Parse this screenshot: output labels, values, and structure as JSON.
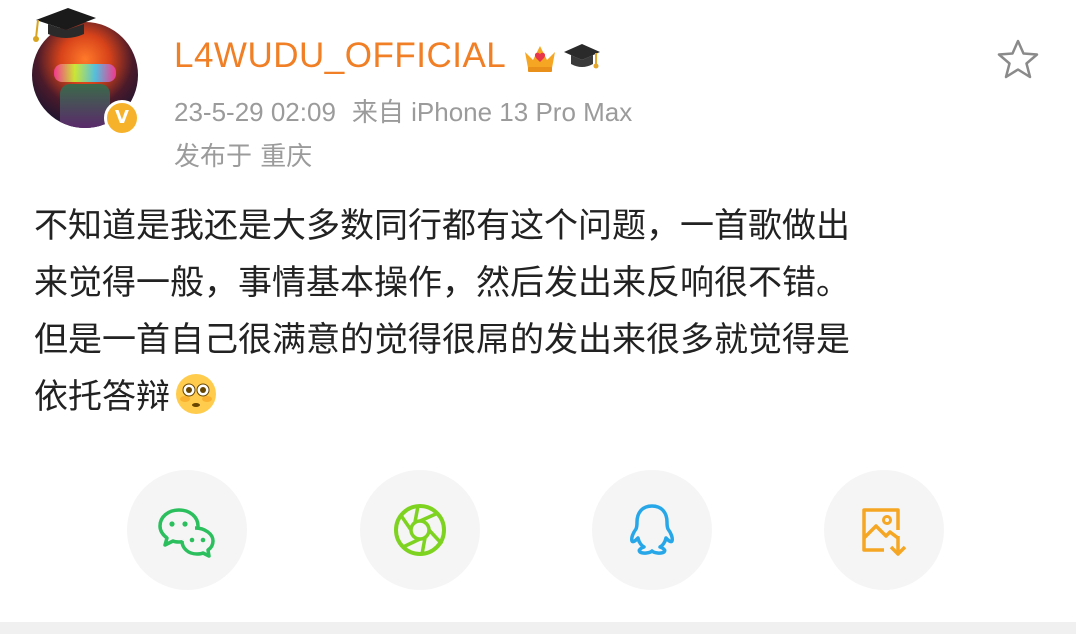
{
  "post": {
    "username": "L4WUDU_OFFICIAL",
    "timestamp": "23-5-29 02:09",
    "source": "来自 iPhone 13 Pro Max",
    "location": "发布于 重庆",
    "text_line1": "不知道是我还是大多数同行都有这个问题，一首歌做出",
    "text_line2": "来觉得一般，事情基本操作，然后发出来反响很不错。",
    "text_line3": "但是一首自己很满意的觉得很屌的发出来很多就觉得是",
    "text_line4": "依托答辩",
    "verified_mark": "V",
    "emoji": "flushed-face"
  },
  "colors": {
    "username": "#f07f25",
    "meta": "#9b9b9b",
    "verified": "#f6b22b",
    "wechat": "#2bbf5e",
    "moments": "#7ed321",
    "qq": "#28a7e8",
    "save_image": "#f5a623"
  },
  "share": {
    "items": [
      "wechat-icon",
      "moments-icon",
      "qq-icon",
      "save-image-icon"
    ]
  }
}
